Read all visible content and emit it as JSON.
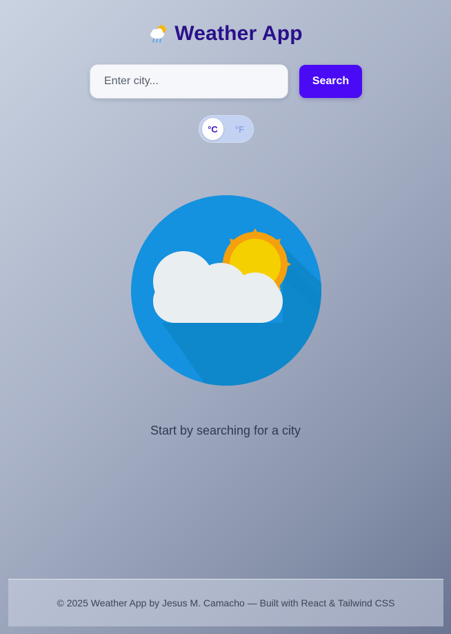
{
  "header": {
    "icon": "sun-behind-rain-cloud-icon",
    "title": "Weather App"
  },
  "search": {
    "placeholder": "Enter city...",
    "value": "",
    "button_label": "Search"
  },
  "units": {
    "celsius_label": "°C",
    "fahrenheit_label": "°F",
    "selected": "°C"
  },
  "main": {
    "illustration": "sun-and-cloud-icon",
    "prompt": "Start by searching for a city"
  },
  "footer": {
    "text": "© 2025 Weather App by Jesus M. Camacho — Built with React & Tailwind CSS"
  },
  "colors": {
    "title": "#2a108a",
    "accent": "#4a0af5",
    "illustration_circle": "#1491df",
    "sun": "#f5d000",
    "sun_rays": "#f5a00f",
    "cloud": "#e9eef0"
  }
}
